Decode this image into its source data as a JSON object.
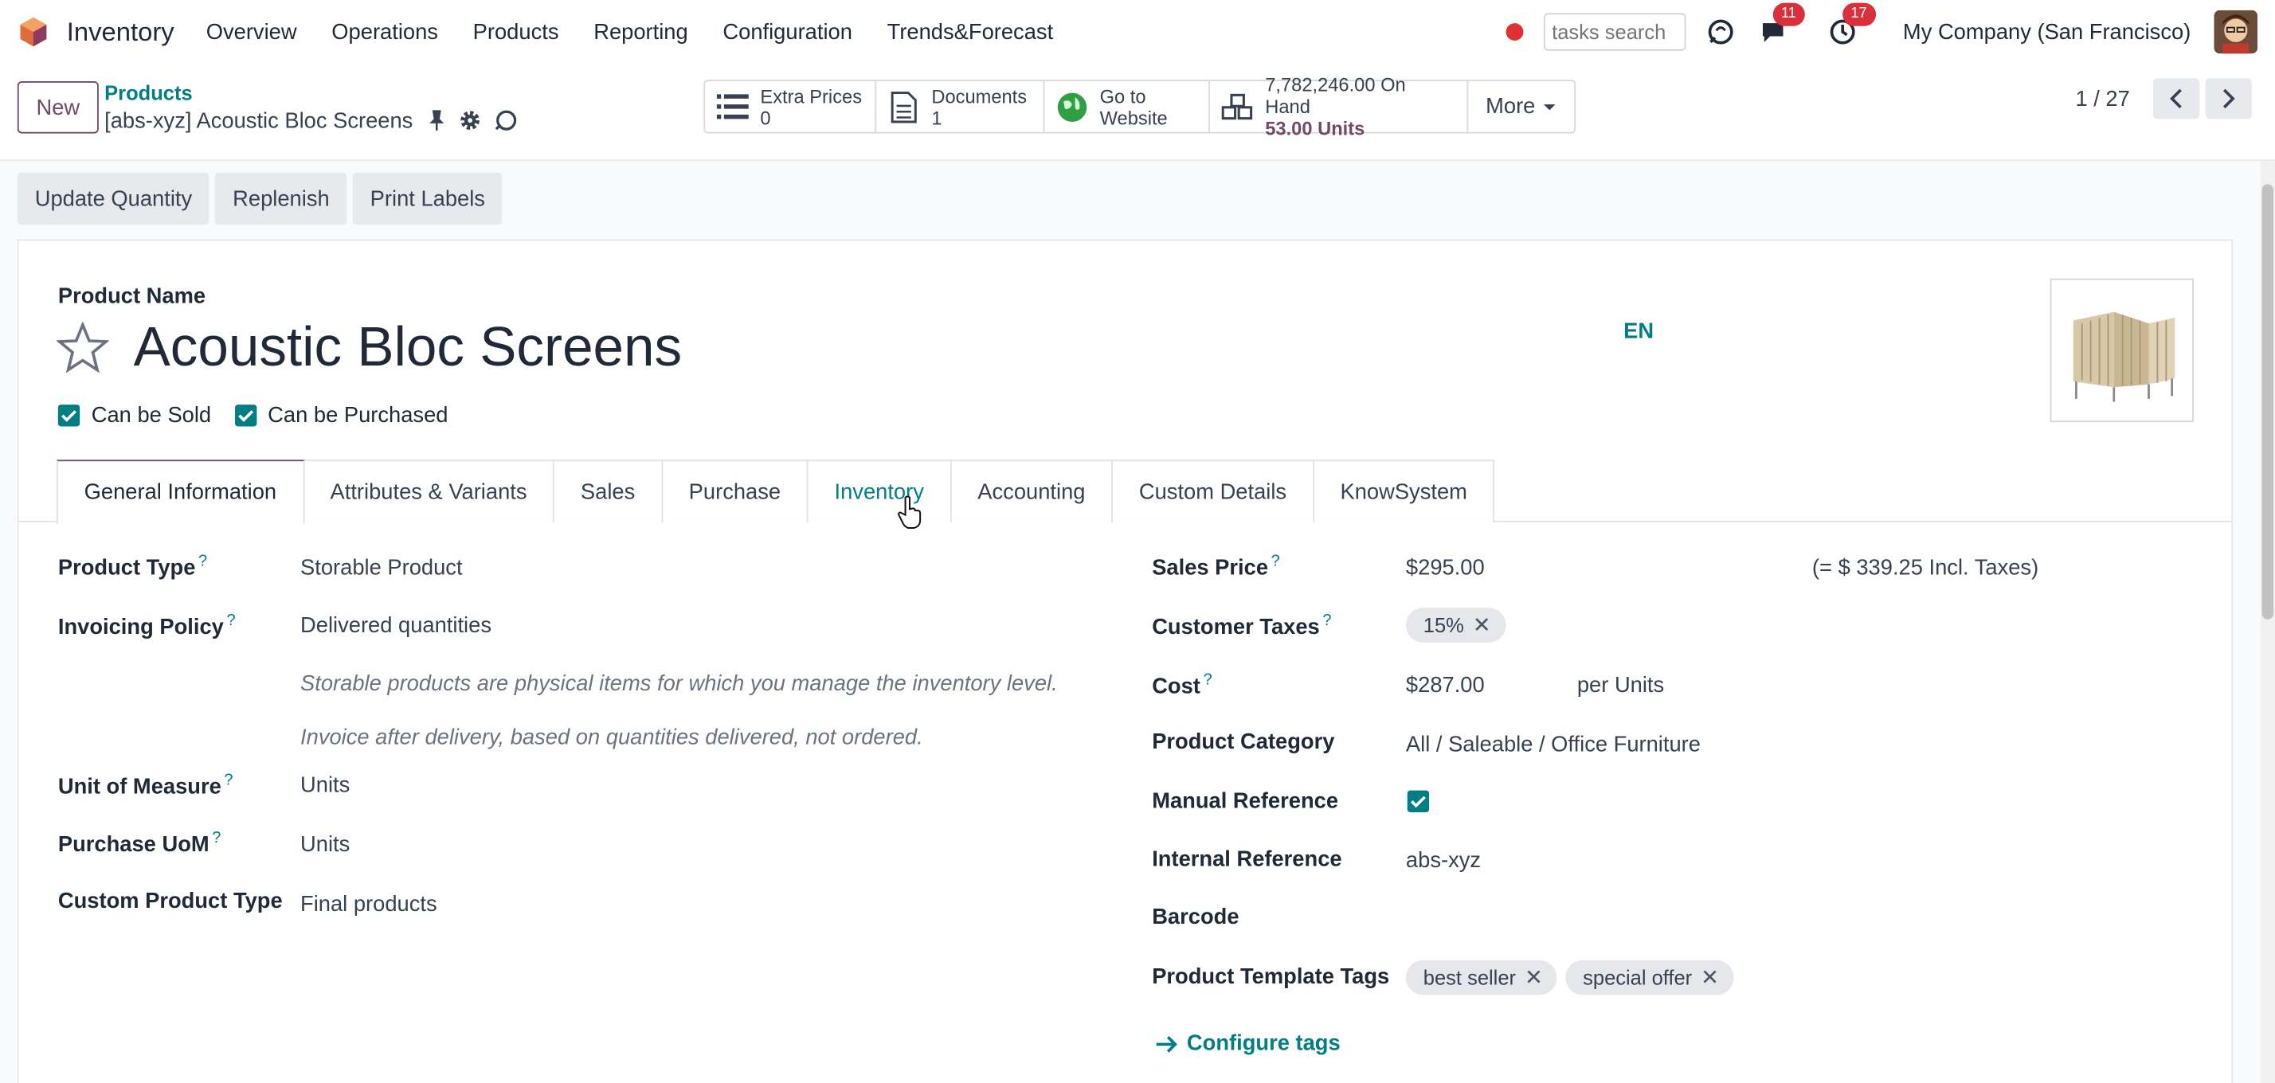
{
  "app": {
    "name": "Inventory"
  },
  "menu": [
    "Overview",
    "Operations",
    "Products",
    "Reporting",
    "Configuration",
    "Trends&Forecast"
  ],
  "nav_right": {
    "search_placeholder": "tasks search",
    "messages_count": "11",
    "activities_count": "17",
    "company": "My Company (San Francisco)"
  },
  "control_panel": {
    "new_label": "New",
    "breadcrumb": "Products",
    "record_title": "[abs-xyz] Acoustic Bloc Screens",
    "pager": "1 / 27"
  },
  "smart_buttons": {
    "extra_prices": {
      "label": "Extra Prices",
      "value": "0"
    },
    "documents": {
      "label": "Documents",
      "value": "1"
    },
    "website": {
      "line1": "Go to",
      "line2": "Website"
    },
    "on_hand": {
      "line1": "7,782,246.00 On Hand",
      "line2": "53.00 Units"
    },
    "more": "More"
  },
  "actions": [
    "Update Quantity",
    "Replenish",
    "Print Labels"
  ],
  "form": {
    "product_name_label": "Product Name",
    "product_name": "Acoustic Bloc Screens",
    "lang": "EN",
    "can_be_sold": "Can be Sold",
    "can_be_purchased": "Can be Purchased"
  },
  "tabs": [
    "General Information",
    "Attributes & Variants",
    "Sales",
    "Purchase",
    "Inventory",
    "Accounting",
    "Custom Details",
    "KnowSystem"
  ],
  "left_fields": {
    "product_type": {
      "label": "Product Type",
      "value": "Storable Product"
    },
    "invoicing_policy": {
      "label": "Invoicing Policy",
      "value": "Delivered quantities"
    },
    "help1": "Storable products are physical items for which you manage the inventory level.",
    "help2": "Invoice after delivery, based on quantities delivered, not ordered.",
    "uom": {
      "label": "Unit of Measure",
      "value": "Units"
    },
    "purchase_uom": {
      "label": "Purchase UoM",
      "value": "Units"
    },
    "custom_type": {
      "label": "Custom Product Type",
      "value": "Final products"
    }
  },
  "right_fields": {
    "sales_price": {
      "label": "Sales Price",
      "value": "$295.00",
      "incl": "(= $ 339.25 Incl. Taxes)"
    },
    "customer_taxes": {
      "label": "Customer Taxes",
      "tag": "15%"
    },
    "cost": {
      "label": "Cost",
      "value": "$287.00",
      "per": "per Units"
    },
    "category": {
      "label": "Product Category",
      "value": "All / Saleable / Office Furniture"
    },
    "manual_ref": {
      "label": "Manual Reference"
    },
    "internal_ref": {
      "label": "Internal Reference",
      "value": "abs-xyz"
    },
    "barcode": {
      "label": "Barcode"
    },
    "template_tags": {
      "label": "Product Template Tags",
      "tags": [
        "best seller",
        "special offer"
      ]
    },
    "configure_tags": "Configure tags"
  },
  "help_mark": "?"
}
